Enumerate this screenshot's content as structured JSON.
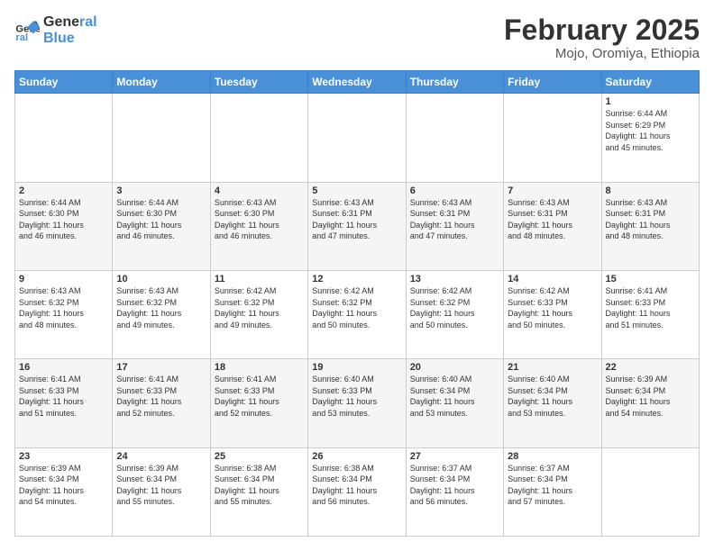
{
  "logo": {
    "line1": "General",
    "line2": "Blue"
  },
  "title": "February 2025",
  "subtitle": "Mojo, Oromiya, Ethiopia",
  "weekdays": [
    "Sunday",
    "Monday",
    "Tuesday",
    "Wednesday",
    "Thursday",
    "Friday",
    "Saturday"
  ],
  "weeks": [
    [
      {
        "day": "",
        "info": ""
      },
      {
        "day": "",
        "info": ""
      },
      {
        "day": "",
        "info": ""
      },
      {
        "day": "",
        "info": ""
      },
      {
        "day": "",
        "info": ""
      },
      {
        "day": "",
        "info": ""
      },
      {
        "day": "1",
        "info": "Sunrise: 6:44 AM\nSunset: 6:29 PM\nDaylight: 11 hours\nand 45 minutes."
      }
    ],
    [
      {
        "day": "2",
        "info": "Sunrise: 6:44 AM\nSunset: 6:30 PM\nDaylight: 11 hours\nand 46 minutes."
      },
      {
        "day": "3",
        "info": "Sunrise: 6:44 AM\nSunset: 6:30 PM\nDaylight: 11 hours\nand 46 minutes."
      },
      {
        "day": "4",
        "info": "Sunrise: 6:43 AM\nSunset: 6:30 PM\nDaylight: 11 hours\nand 46 minutes."
      },
      {
        "day": "5",
        "info": "Sunrise: 6:43 AM\nSunset: 6:31 PM\nDaylight: 11 hours\nand 47 minutes."
      },
      {
        "day": "6",
        "info": "Sunrise: 6:43 AM\nSunset: 6:31 PM\nDaylight: 11 hours\nand 47 minutes."
      },
      {
        "day": "7",
        "info": "Sunrise: 6:43 AM\nSunset: 6:31 PM\nDaylight: 11 hours\nand 48 minutes."
      },
      {
        "day": "8",
        "info": "Sunrise: 6:43 AM\nSunset: 6:31 PM\nDaylight: 11 hours\nand 48 minutes."
      }
    ],
    [
      {
        "day": "9",
        "info": "Sunrise: 6:43 AM\nSunset: 6:32 PM\nDaylight: 11 hours\nand 48 minutes."
      },
      {
        "day": "10",
        "info": "Sunrise: 6:43 AM\nSunset: 6:32 PM\nDaylight: 11 hours\nand 49 minutes."
      },
      {
        "day": "11",
        "info": "Sunrise: 6:42 AM\nSunset: 6:32 PM\nDaylight: 11 hours\nand 49 minutes."
      },
      {
        "day": "12",
        "info": "Sunrise: 6:42 AM\nSunset: 6:32 PM\nDaylight: 11 hours\nand 50 minutes."
      },
      {
        "day": "13",
        "info": "Sunrise: 6:42 AM\nSunset: 6:32 PM\nDaylight: 11 hours\nand 50 minutes."
      },
      {
        "day": "14",
        "info": "Sunrise: 6:42 AM\nSunset: 6:33 PM\nDaylight: 11 hours\nand 50 minutes."
      },
      {
        "day": "15",
        "info": "Sunrise: 6:41 AM\nSunset: 6:33 PM\nDaylight: 11 hours\nand 51 minutes."
      }
    ],
    [
      {
        "day": "16",
        "info": "Sunrise: 6:41 AM\nSunset: 6:33 PM\nDaylight: 11 hours\nand 51 minutes."
      },
      {
        "day": "17",
        "info": "Sunrise: 6:41 AM\nSunset: 6:33 PM\nDaylight: 11 hours\nand 52 minutes."
      },
      {
        "day": "18",
        "info": "Sunrise: 6:41 AM\nSunset: 6:33 PM\nDaylight: 11 hours\nand 52 minutes."
      },
      {
        "day": "19",
        "info": "Sunrise: 6:40 AM\nSunset: 6:33 PM\nDaylight: 11 hours\nand 53 minutes."
      },
      {
        "day": "20",
        "info": "Sunrise: 6:40 AM\nSunset: 6:34 PM\nDaylight: 11 hours\nand 53 minutes."
      },
      {
        "day": "21",
        "info": "Sunrise: 6:40 AM\nSunset: 6:34 PM\nDaylight: 11 hours\nand 53 minutes."
      },
      {
        "day": "22",
        "info": "Sunrise: 6:39 AM\nSunset: 6:34 PM\nDaylight: 11 hours\nand 54 minutes."
      }
    ],
    [
      {
        "day": "23",
        "info": "Sunrise: 6:39 AM\nSunset: 6:34 PM\nDaylight: 11 hours\nand 54 minutes."
      },
      {
        "day": "24",
        "info": "Sunrise: 6:39 AM\nSunset: 6:34 PM\nDaylight: 11 hours\nand 55 minutes."
      },
      {
        "day": "25",
        "info": "Sunrise: 6:38 AM\nSunset: 6:34 PM\nDaylight: 11 hours\nand 55 minutes."
      },
      {
        "day": "26",
        "info": "Sunrise: 6:38 AM\nSunset: 6:34 PM\nDaylight: 11 hours\nand 56 minutes."
      },
      {
        "day": "27",
        "info": "Sunrise: 6:37 AM\nSunset: 6:34 PM\nDaylight: 11 hours\nand 56 minutes."
      },
      {
        "day": "28",
        "info": "Sunrise: 6:37 AM\nSunset: 6:34 PM\nDaylight: 11 hours\nand 57 minutes."
      },
      {
        "day": "",
        "info": ""
      }
    ]
  ]
}
